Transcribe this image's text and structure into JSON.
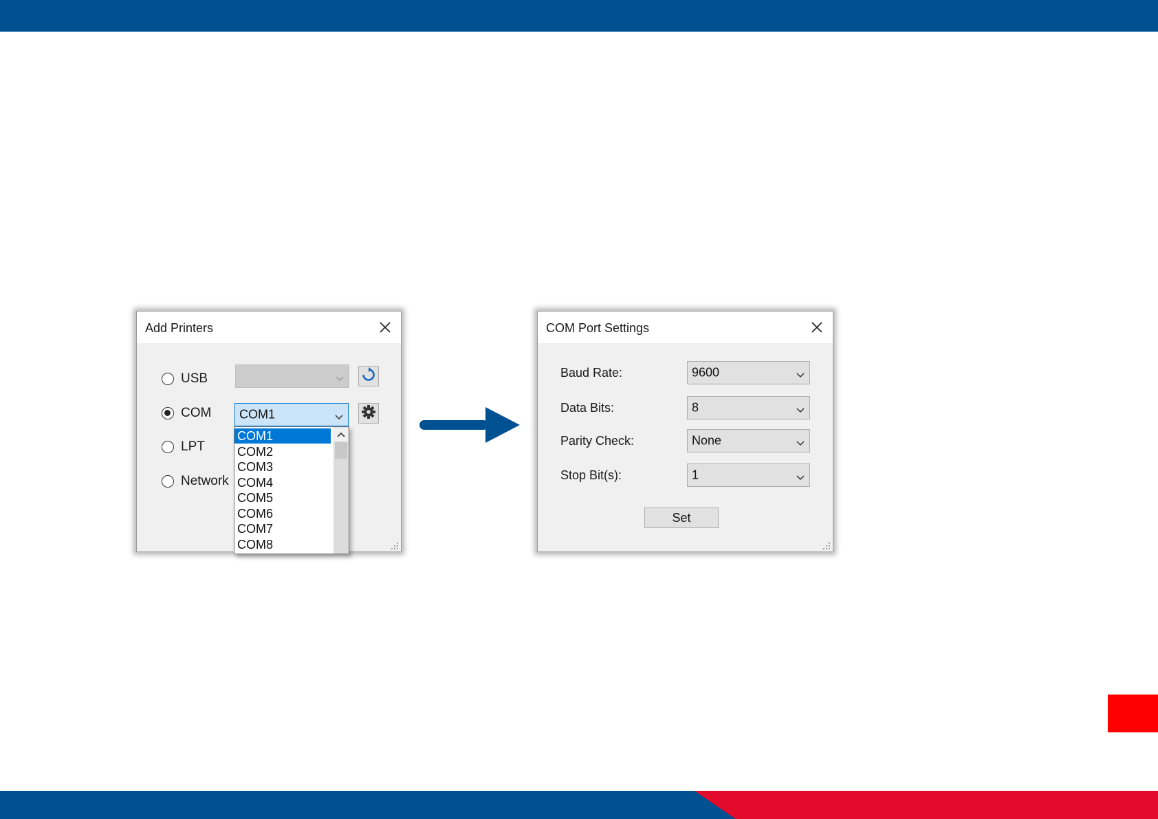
{
  "add_printers": {
    "title": "Add Printers",
    "radios": [
      {
        "label": "USB",
        "checked": false
      },
      {
        "label": "COM",
        "checked": true
      },
      {
        "label": "LPT",
        "checked": false
      },
      {
        "label": "Network",
        "checked": false
      }
    ],
    "usb_combo_value": "",
    "com_combo_value": "COM1",
    "com_options": [
      "COM1",
      "COM2",
      "COM3",
      "COM4",
      "COM5",
      "COM6",
      "COM7",
      "COM8"
    ],
    "selected_option": "COM1"
  },
  "com_port_settings": {
    "title": "COM Port Settings",
    "fields": [
      {
        "label": "Baud Rate:",
        "value": "9600"
      },
      {
        "label": "Data Bits:",
        "value": "8"
      },
      {
        "label": "Parity Check:",
        "value": "None"
      },
      {
        "label": "Stop Bit(s):",
        "value": "1"
      }
    ],
    "set_label": "Set"
  },
  "icons": {
    "refresh": "refresh-icon",
    "settings": "gear-icon",
    "close": "close-icon",
    "arrow": "arrow-right-icon"
  },
  "colors": {
    "brand_blue": "#005192",
    "brand_red": "#e30b2b",
    "selection_blue": "#0078d7"
  }
}
